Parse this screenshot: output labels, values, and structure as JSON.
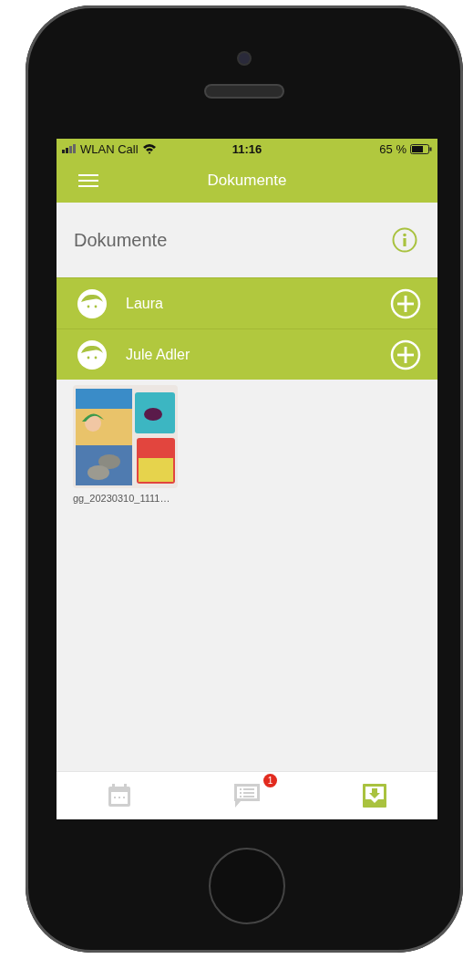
{
  "status_bar": {
    "carrier": "WLAN Call",
    "time": "11:16",
    "battery": "65 %"
  },
  "app_bar": {
    "title": "Dokumente"
  },
  "section": {
    "title": "Dokumente"
  },
  "people": [
    {
      "name": "Laura"
    },
    {
      "name": "Jule Adler"
    }
  ],
  "documents": [
    {
      "kind": "picture",
      "filename": "gg_20230310_1111…"
    }
  ],
  "tab_bar": [
    {
      "kind": "calendar",
      "selected": false
    },
    {
      "kind": "messages",
      "selected": false,
      "badge": "1"
    },
    {
      "kind": "documents",
      "selected": true
    }
  ]
}
